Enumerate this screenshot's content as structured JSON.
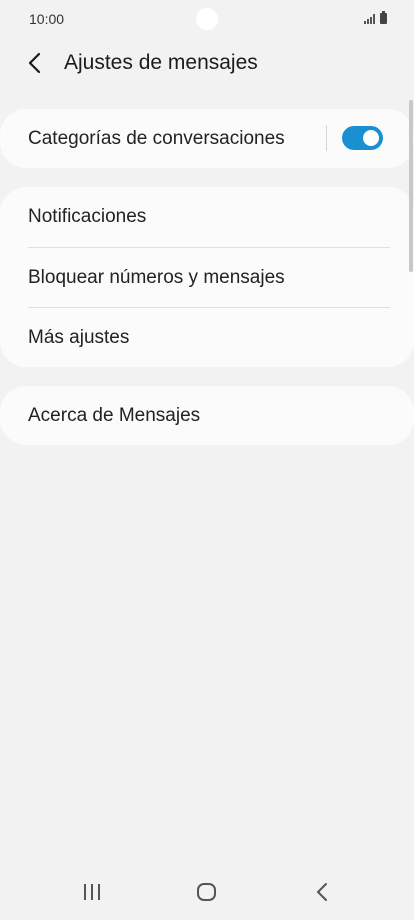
{
  "status_bar": {
    "time": "10:00"
  },
  "header": {
    "title": "Ajustes de mensajes",
    "back_icon": "chevron-left-icon"
  },
  "sections": [
    {
      "items": [
        {
          "label": "Categorías de conversaciones",
          "toggle": true
        }
      ]
    },
    {
      "items": [
        {
          "label": "Notificaciones"
        },
        {
          "label": "Bloquear números y mensajes"
        },
        {
          "label": "Más ajustes"
        }
      ]
    },
    {
      "items": [
        {
          "label": "Acerca de Mensajes"
        }
      ]
    }
  ],
  "nav_bar": {
    "icons": [
      "recent-apps-icon",
      "home-icon",
      "back-icon"
    ]
  },
  "colors": {
    "background": "#f2f2f2",
    "card": "#fbfbfb",
    "accent": "#1a8fd1"
  }
}
